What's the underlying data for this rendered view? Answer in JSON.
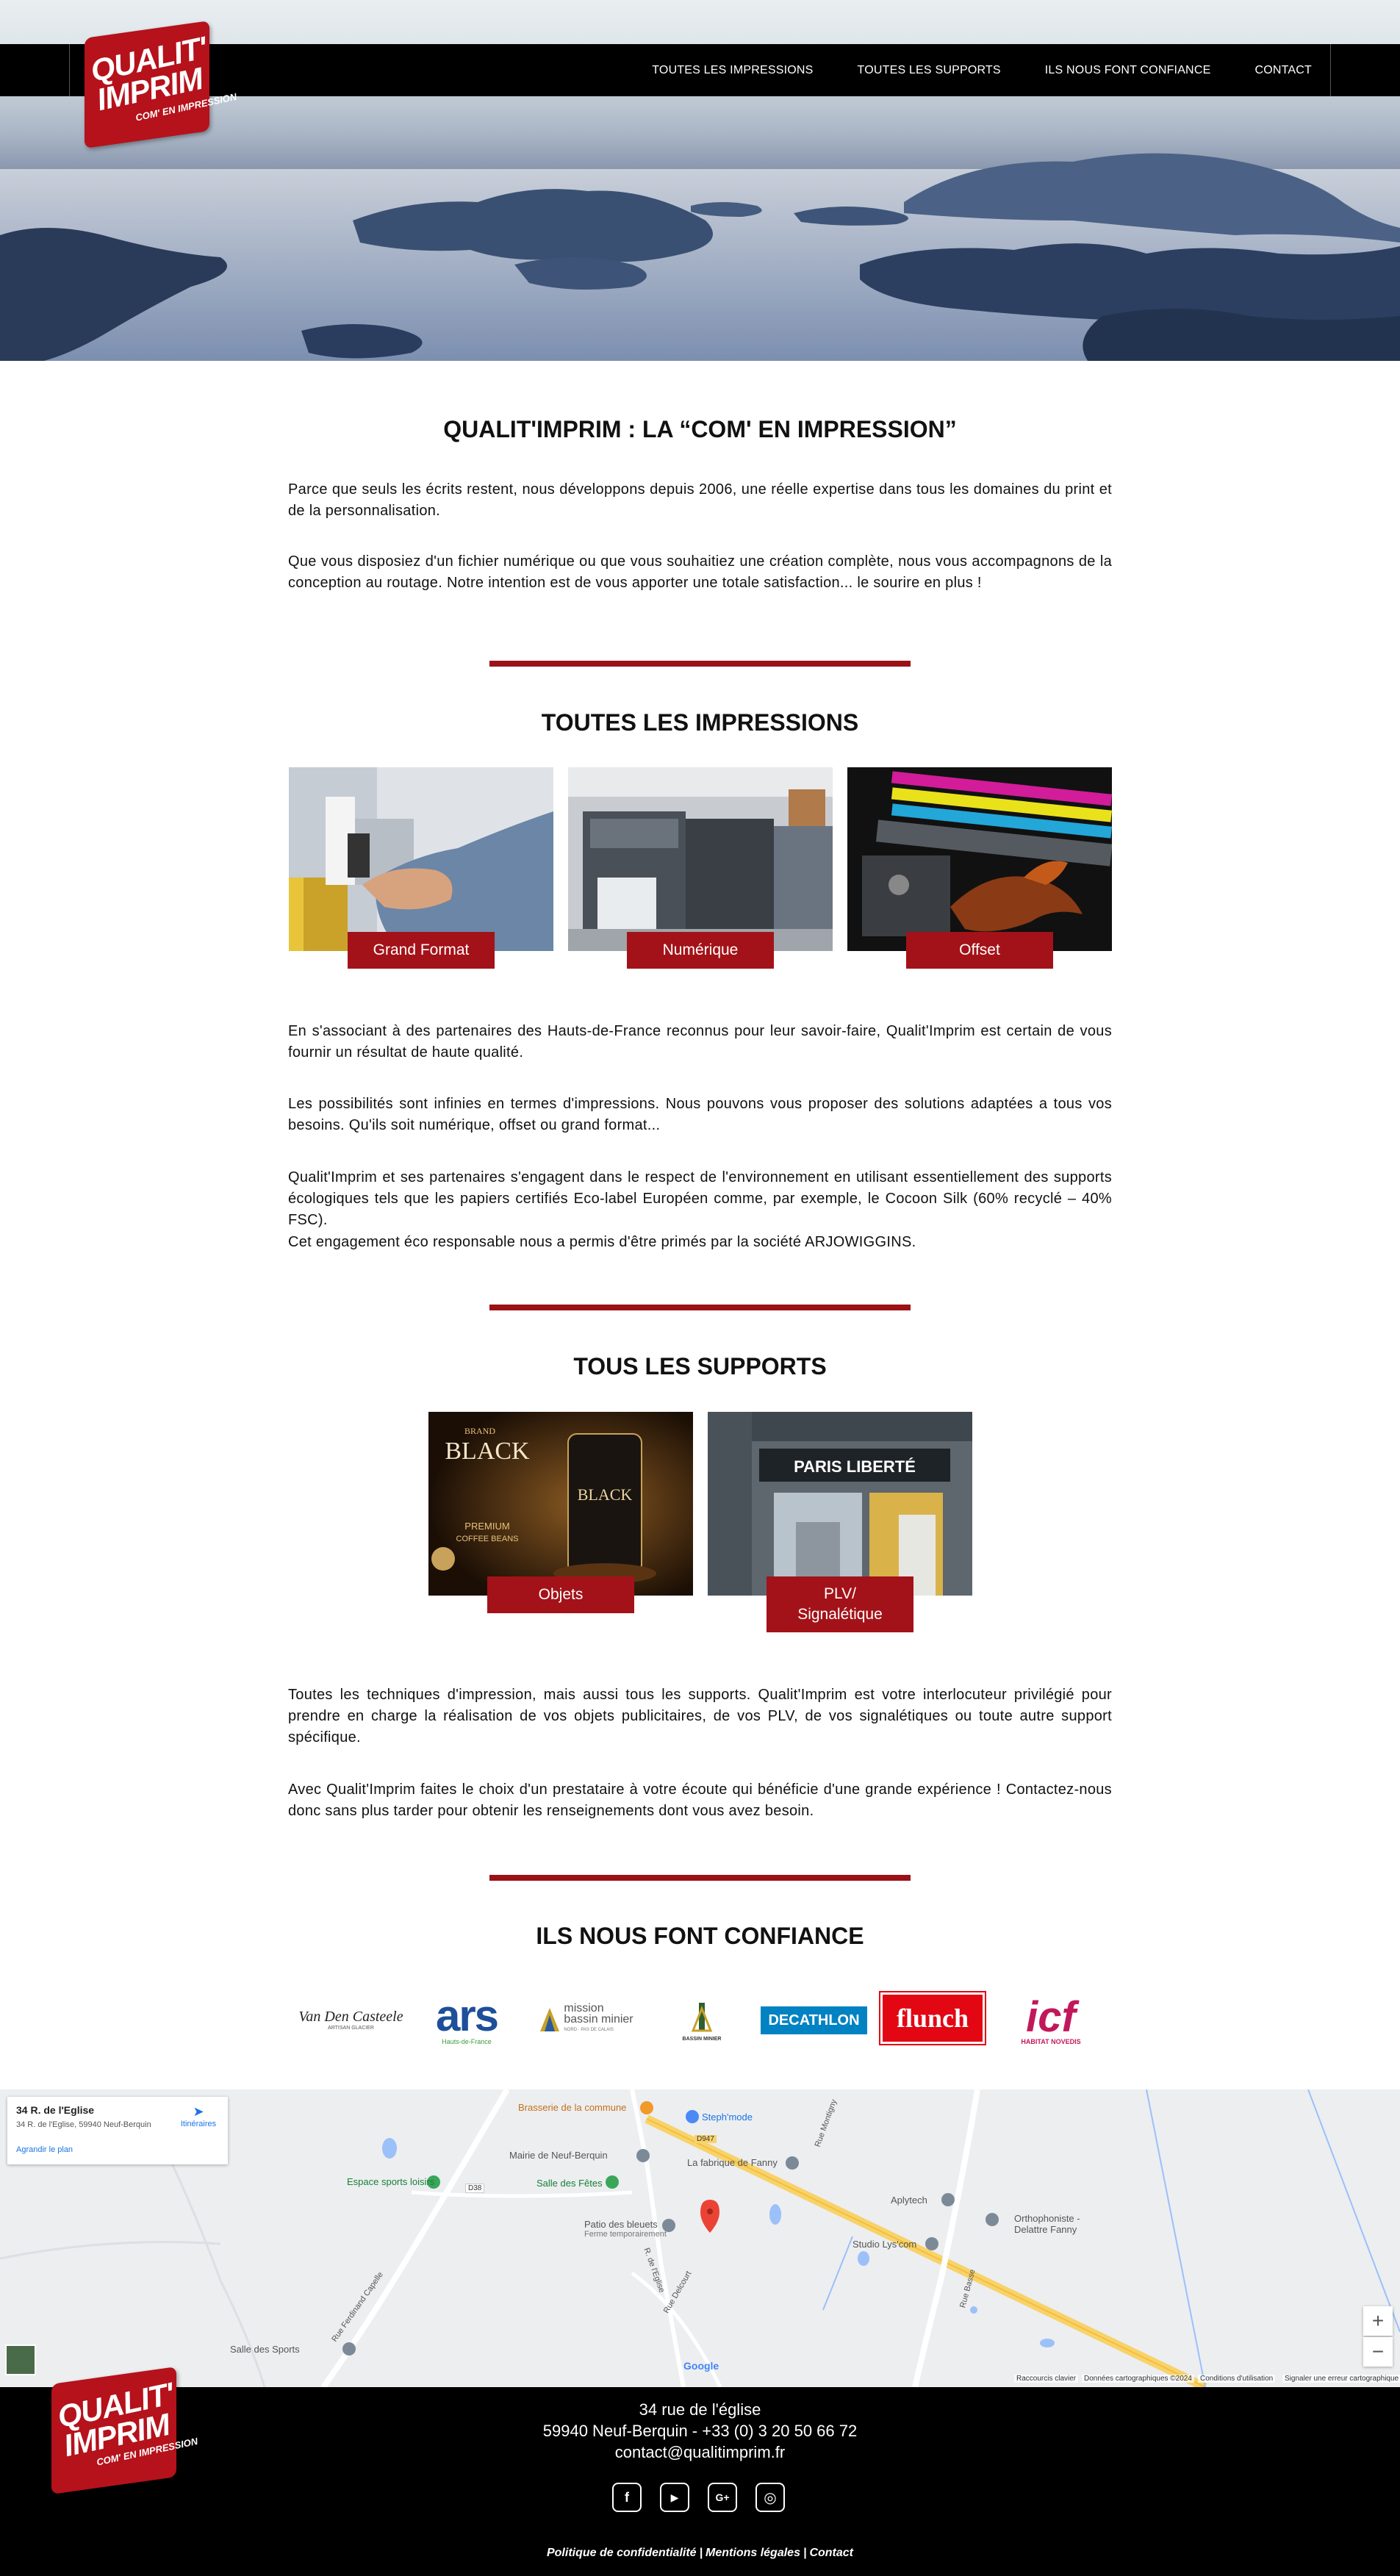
{
  "brand": {
    "logo_line1": "QUALIT'",
    "logo_line2": "IMPRIM",
    "logo_tagline": "COM' EN IMPRESSION",
    "accent_color": "#a31218"
  },
  "nav": {
    "items": [
      "TOUTES LES IMPRESSIONS",
      "TOUTES LES SUPPORTS",
      "ILS NOUS FONT CONFIANCE",
      "CONTACT"
    ]
  },
  "intro": {
    "title_bold": "QUALIT'IMPRIM :",
    "title_rest": " LA “COM' EN IMPRESSION”",
    "paragraphs": [
      "Parce que seuls les écrits restent, nous développons depuis 2006, une réelle expertise dans tous les domaines du print et de la personnalisation.",
      "Que vous disposiez d'un fichier numérique ou que vous souhaitiez une création complète, nous vous accompagnons de la conception au routage. Notre intention est de vous apporter une totale satisfaction... le sourire en plus !"
    ]
  },
  "impressions": {
    "title": "TOUTES LES IMPRESSIONS",
    "cards": [
      {
        "label": "Grand Format",
        "image": "hand-printer-photo"
      },
      {
        "label": "Numérique",
        "image": "digital-press-photo"
      },
      {
        "label": "Offset",
        "image": "offset-rollers-photo"
      }
    ],
    "paragraphs": [
      "En s'associant à des partenaires des Hauts-de-France reconnus pour leur savoir-faire, Qualit'Imprim est certain de vous fournir un résultat de haute qualité.",
      "Les possibilités sont infinies en termes d'impressions. Nous pouvons vous proposer des solutions adaptées a tous vos besoins. Qu'ils soit numérique, offset ou grand format...",
      "Qualit'Imprim et ses partenaires s'engagent dans le respect de l'environnement en utilisant essentiellement des supports écologiques tels que les papiers certifiés Eco-label Européen comme, par exemple, le Cocoon Silk (60% recyclé – 40% FSC).",
      "Cet engagement éco responsable nous a permis d'être primés par la société ARJOWIGGINS."
    ]
  },
  "supports": {
    "title": "TOUS LES SUPPORTS",
    "cards": [
      {
        "label": "Objets",
        "image": "coffee-can-photo",
        "img_text_1": "BRAND",
        "img_text_2": "BLACK",
        "img_text_3": "PREMIUM",
        "img_text_4": "COFFEE BEANS"
      },
      {
        "label_1": "PLV/",
        "label_2": "Signalétique",
        "image": "storefront-photo",
        "img_text": "PARIS LIBERTÉ"
      }
    ],
    "paragraphs": [
      "Toutes les techniques d'impression, mais aussi tous les supports. Qualit'Imprim est votre interlocuteur privilégié pour prendre en charge la réalisation de vos objets publicitaires, de vos PLV, de vos signalétiques ou toute autre support spécifique.",
      "Avec Qualit'Imprim faites le choix d'un prestataire à votre écoute qui bénéficie d'une grande expérience ! Contactez-nous donc sans plus tarder pour obtenir les renseignements dont vous avez besoin."
    ]
  },
  "partners": {
    "title": "ILS NOUS FONT CONFIANCE",
    "logos": [
      {
        "name": "Van Den Casteele",
        "sub": "ARTISAN GLACIER"
      },
      {
        "name": "ars",
        "sub": "Hauts-de-France"
      },
      {
        "name": "mission",
        "name2": "bassin minier",
        "sub": "NORD · PAS DE CALAIS"
      },
      {
        "name": "BASSIN MINIER"
      },
      {
        "name": "DECATHLON"
      },
      {
        "name": "flunch"
      },
      {
        "name": "icf",
        "sub": "HABITAT NOVEDIS"
      }
    ]
  },
  "map": {
    "place_title": "34 R. de l'Eglise",
    "place_address": "34 R. de l'Eglise, 59940 Neuf-Berquin",
    "directions": "Itinéraires",
    "enlarge": "Agrandir le plan",
    "labels": [
      "Brasserie de la commune",
      "Steph'mode",
      "Mairie de Neuf-Berquin",
      "La fabrique de Fanny",
      "Espace sports loisirs",
      "Salle des Fêtes",
      "Aplytech",
      "Orthophoniste - Delattre Fanny",
      "Patio des bleuets",
      "Ferme temporairement",
      "Studio Lys'com",
      "Salle des Sports",
      "Rue Ferdinand Capelle",
      "R. de l'Eglise",
      "Rue Delcourt",
      "Rue Montigny",
      "Rue Basse",
      "D947",
      "D38"
    ],
    "attribution": [
      "Raccourcis clavier",
      "Données cartographiques ©2024",
      "Conditions d'utilisation",
      "Signaler une erreur cartographique"
    ],
    "google": "Google",
    "zoom_in": "+",
    "zoom_out": "−"
  },
  "footer": {
    "address_1": "34 rue de l'église",
    "address_2": "59940 Neuf-Berquin - +33 (0) 3 20 50 66 72",
    "email": "contact@qualitimprim.fr",
    "social": [
      {
        "icon": "facebook-icon",
        "glyph": "f"
      },
      {
        "icon": "youtube-icon",
        "glyph": "▶"
      },
      {
        "icon": "googleplus-icon",
        "glyph": "G+"
      },
      {
        "icon": "instagram-icon",
        "glyph": "◎"
      }
    ],
    "legal": [
      "Politique de confidentialité",
      "Mentions légales",
      "Contact"
    ]
  }
}
